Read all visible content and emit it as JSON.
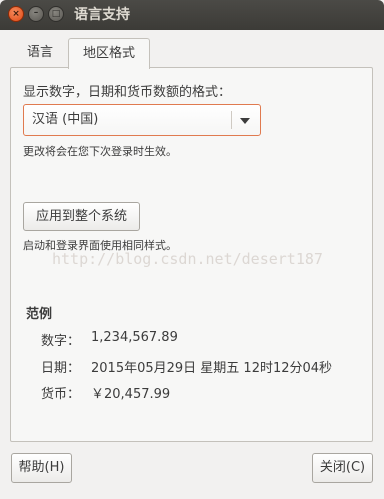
{
  "window": {
    "title": "语言支持",
    "close_glyph": "×",
    "min_glyph": "–",
    "max_glyph": "□"
  },
  "tabs": [
    {
      "label": "语言",
      "active": false
    },
    {
      "label": "地区格式",
      "active": true
    }
  ],
  "regional": {
    "format_label": "显示数字，日期和货币数额的格式：",
    "selected_format": "汉语 (中国)",
    "change_note": "更改将会在您下次登录时生效。",
    "apply_button": "应用到整个系统",
    "apply_note": "启动和登录界面使用相同样式。"
  },
  "watermark": "http://blog.csdn.net/desert187",
  "example": {
    "title": "范例",
    "number_label": "数字：",
    "number_value": "1,234,567.89",
    "date_label": "日期：",
    "date_value": "2015年05月29日 星期五 12时12分04秒",
    "currency_label": "货币：",
    "currency_value": "￥20,457.99"
  },
  "buttons": {
    "help": "帮助(H)",
    "close": "关闭(C)"
  },
  "colors": {
    "titlebar": "#3c3b37",
    "close_button": "#df4a16",
    "combo_focus_border": "#e07a4f"
  }
}
